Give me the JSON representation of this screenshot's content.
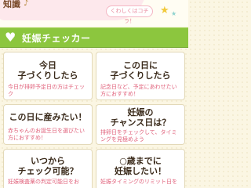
{
  "header": {
    "title": "知識",
    "detail_button": "くわしくはコチラ！"
  },
  "section": {
    "title": "妊娠チェッカー"
  },
  "cards": [
    {
      "title_line1": "今日",
      "title_line2": "子づくりしたら",
      "desc": "今日が排卵予定日の方はチェック"
    },
    {
      "title_line1": "この日に",
      "title_line2": "子づくりしたら",
      "desc": "記念日など、予定にあわせたい方におすすめ！"
    },
    {
      "title_line1": "この日に産みたい！",
      "title_line2": "",
      "desc": "赤ちゃんのお誕生日を選びたい方におすすめ！"
    },
    {
      "title_line1": "妊娠の",
      "title_line2": "チャンス日は？",
      "desc": "排卵日をチェックして、タイミングを見極めよう"
    },
    {
      "title_line1": "いつから",
      "title_line2": "チェック可能？",
      "desc": "妊娠検査薬の判定可能日をお"
    },
    {
      "title_line1": "○歳までに",
      "title_line2": "妊娠したい！",
      "desc": "妊娠タイミングのリミット日を"
    }
  ]
}
